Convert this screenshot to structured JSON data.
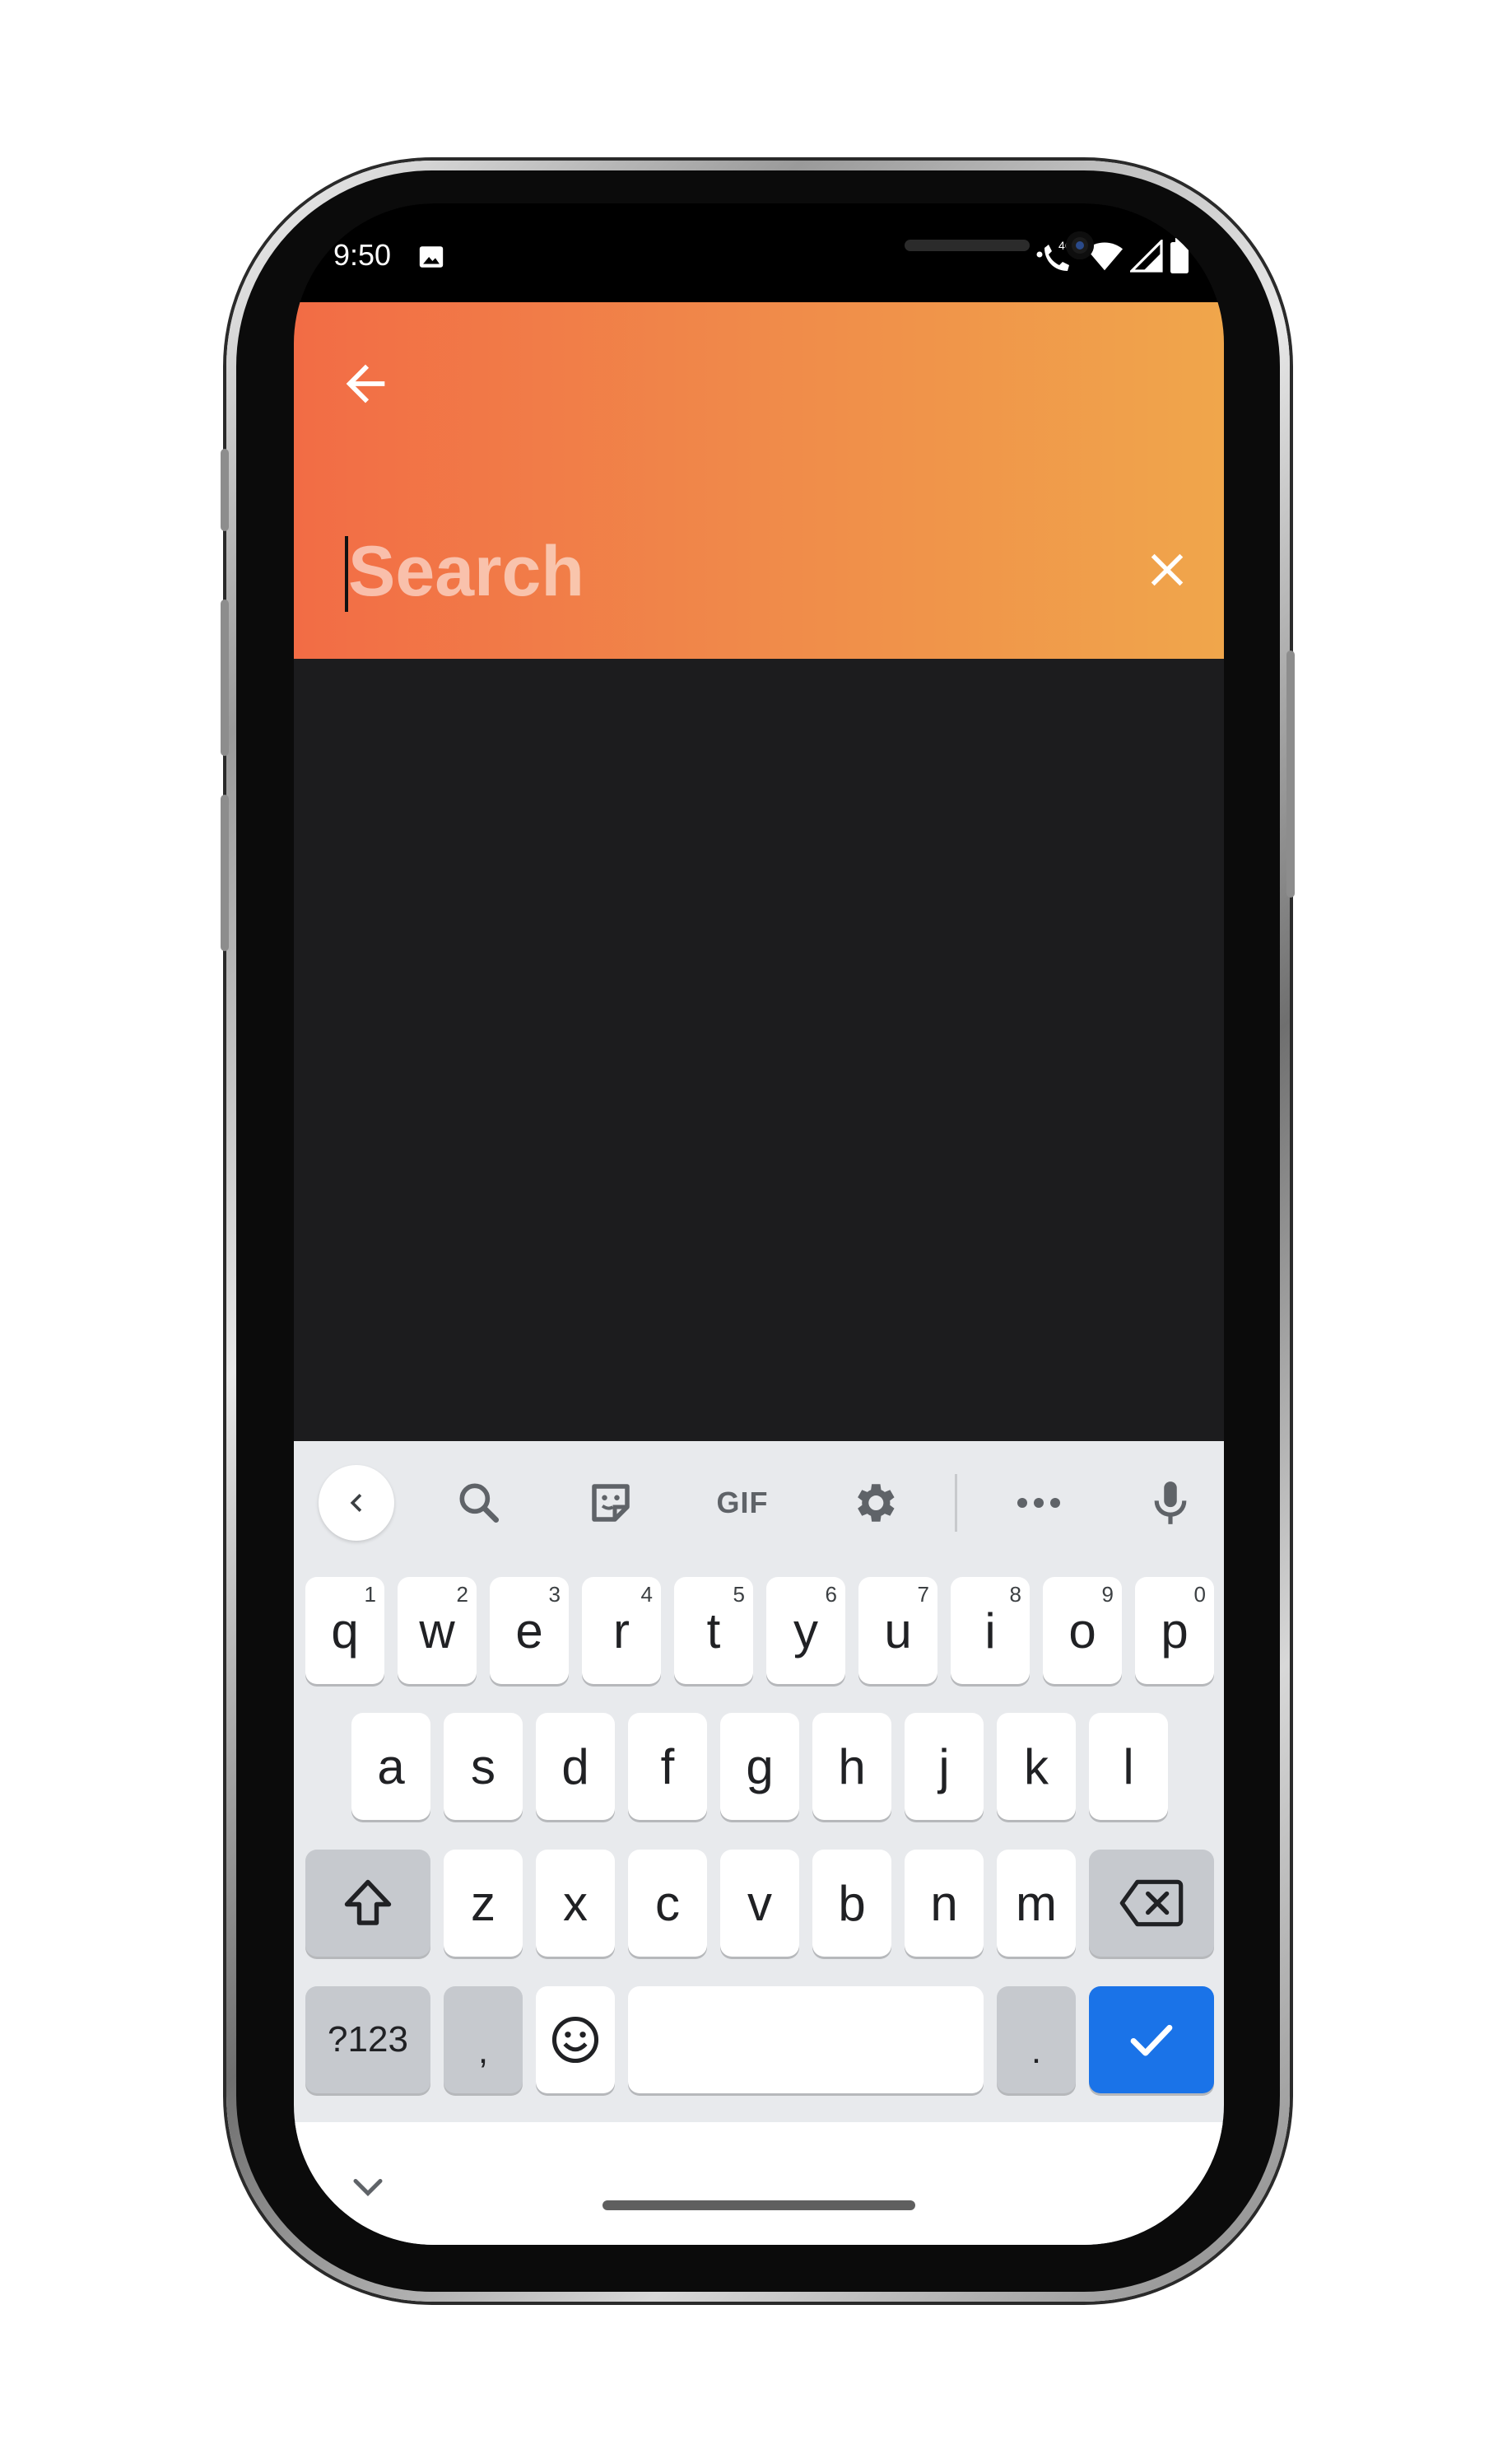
{
  "status_bar": {
    "time": "9:50",
    "network_label": "4G",
    "icons": [
      "gallery-icon",
      "volte-call-icon",
      "wifi-icon",
      "cell-signal-icon",
      "battery-icon"
    ]
  },
  "app_bar": {
    "back_icon": "arrow-left-icon",
    "search_placeholder": "Search",
    "search_value": "",
    "clear_icon": "close-icon",
    "gradient_colors": [
      "#f26c45",
      "#f0a64b"
    ]
  },
  "content": {
    "background": "#1c1c1e"
  },
  "keyboard": {
    "toolbar": {
      "back_icon": "chevron-left-icon",
      "search_icon": "search-icon",
      "sticker_icon": "sticker-icon",
      "gif_label": "GIF",
      "settings_icon": "gear-icon",
      "more_icon": "more-horizontal-icon",
      "mic_icon": "mic-icon"
    },
    "row1": [
      {
        "label": "q",
        "sup": "1"
      },
      {
        "label": "w",
        "sup": "2"
      },
      {
        "label": "e",
        "sup": "3"
      },
      {
        "label": "r",
        "sup": "4"
      },
      {
        "label": "t",
        "sup": "5"
      },
      {
        "label": "y",
        "sup": "6"
      },
      {
        "label": "u",
        "sup": "7"
      },
      {
        "label": "i",
        "sup": "8"
      },
      {
        "label": "o",
        "sup": "9"
      },
      {
        "label": "p",
        "sup": "0"
      }
    ],
    "row2": [
      "a",
      "s",
      "d",
      "f",
      "g",
      "h",
      "j",
      "k",
      "l"
    ],
    "row3": [
      "z",
      "x",
      "c",
      "v",
      "b",
      "n",
      "m"
    ],
    "shift_icon": "shift-icon",
    "backspace_icon": "backspace-icon",
    "symbols_label": "?123",
    "comma_label": ",",
    "emoji_icon": "emoji-icon",
    "period_label": ".",
    "enter_icon": "check-icon",
    "accent_color": "#1a73e8"
  },
  "nav": {
    "hide_keyboard_icon": "chevron-down-icon"
  }
}
